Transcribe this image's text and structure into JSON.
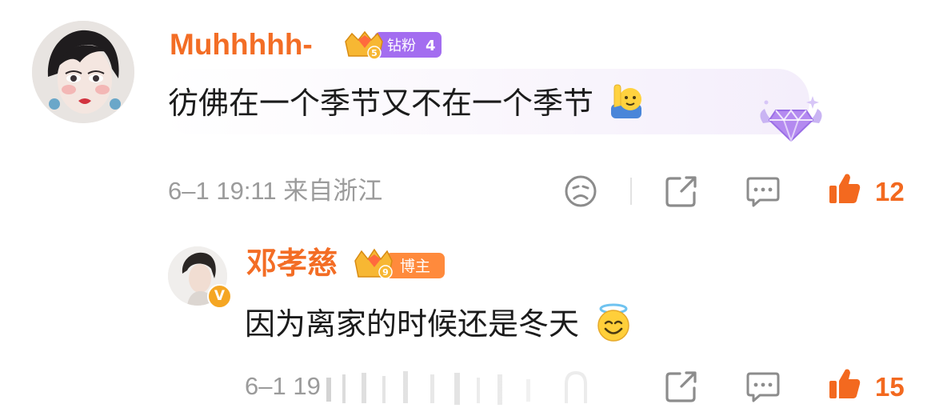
{
  "comments": [
    {
      "username": "Muhhhhh-",
      "badge": {
        "level": "5",
        "label": "钻粉",
        "count": "4"
      },
      "text": "彷佛在一个季节又不在一个季节",
      "emoji": "raising-hand-emoji",
      "meta": "6–1 19:11 来自浙江",
      "likes": "12"
    },
    {
      "username": "邓孝慈",
      "verified": "V",
      "badge": {
        "level": "9",
        "label": "博主"
      },
      "text": "因为离家的时候还是冬天",
      "emoji": "smiling-halo-emoji",
      "meta": "6–1 19",
      "likes": "15"
    }
  ],
  "colors": {
    "username": "#f36d25",
    "like_active": "#f3691f",
    "meta": "#9b9b9b",
    "fan_badge": "#a36df0",
    "blogger_badge": "#ff8a3c"
  }
}
